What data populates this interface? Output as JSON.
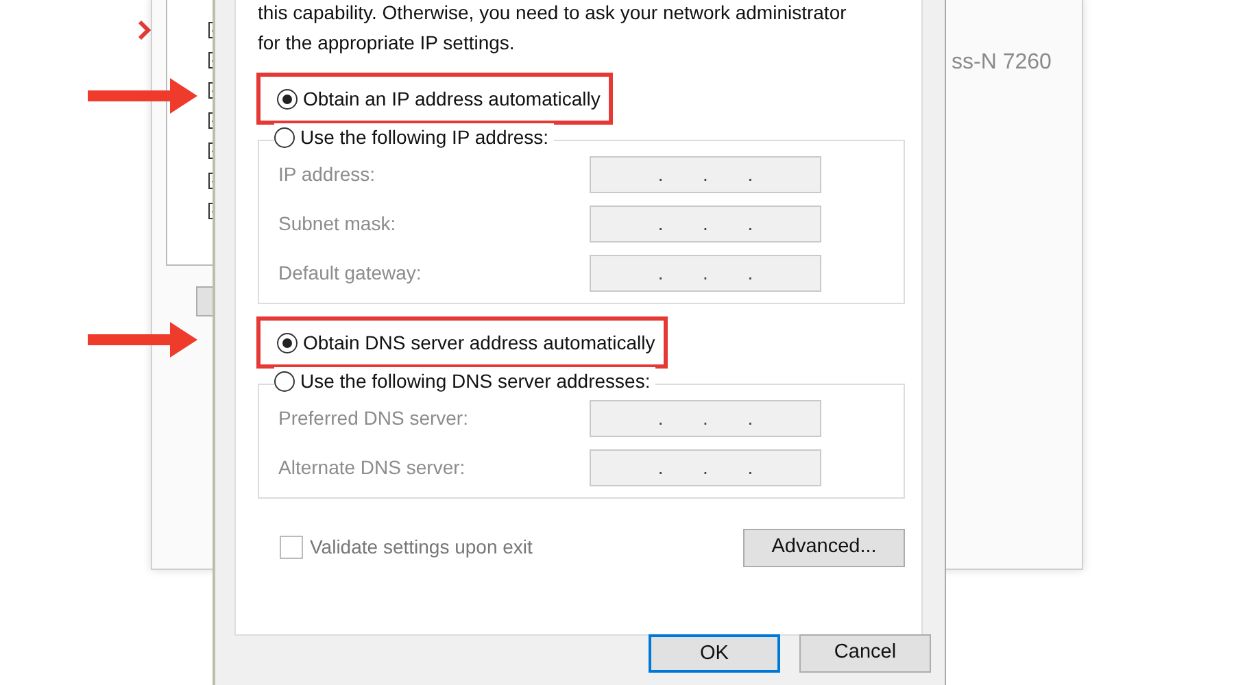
{
  "background_window": {
    "list_checkboxes": [
      {
        "checked": true
      },
      {
        "checked": true
      },
      {
        "checked": true
      },
      {
        "checked": true
      },
      {
        "checked": true
      },
      {
        "checked": true
      },
      {
        "checked": true
      }
    ],
    "adapter_text": "ss-N 7260"
  },
  "dialog": {
    "intro": [
      "this capability. Otherwise, you need to ask your network administrator",
      "for the appropriate IP settings."
    ],
    "sections": [
      {
        "options": [
          {
            "label": "Obtain an IP address automatically",
            "selected": true,
            "highlighted": true
          },
          {
            "label": "Use the following IP address:",
            "selected": false,
            "highlighted": false
          }
        ],
        "fields": [
          {
            "label": "IP address:",
            "disabled": true
          },
          {
            "label": "Subnet mask:",
            "disabled": true
          },
          {
            "label": "Default gateway:",
            "disabled": true
          }
        ]
      },
      {
        "options": [
          {
            "label": "Obtain DNS server address automatically",
            "selected": true,
            "highlighted": true
          },
          {
            "label": "Use the following DNS server addresses:",
            "selected": false,
            "highlighted": false
          }
        ],
        "fields": [
          {
            "label": "Preferred DNS server:",
            "disabled": true
          },
          {
            "label": "Alternate DNS server:",
            "disabled": true
          }
        ]
      }
    ],
    "ip_separator": ".",
    "validate": {
      "label": "Validate settings upon exit",
      "checked": false,
      "disabled": true
    },
    "advanced_button": "Advanced...",
    "buttons": [
      {
        "label": "OK",
        "default": true
      },
      {
        "label": "Cancel",
        "default": false
      }
    ]
  }
}
